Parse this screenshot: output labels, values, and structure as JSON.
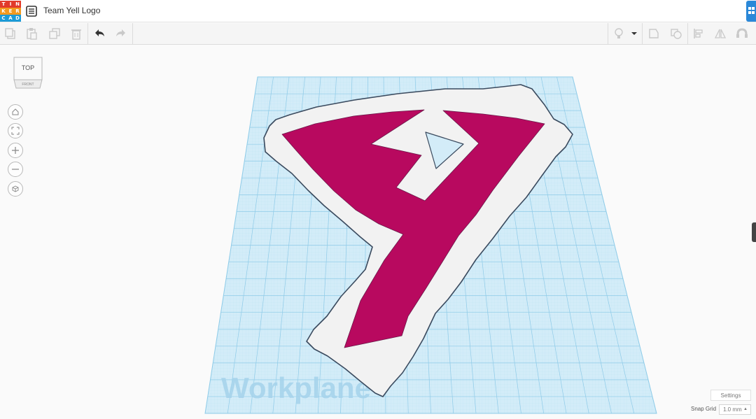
{
  "app": {
    "logo_letters": [
      "T",
      "I",
      "N",
      "K",
      "E",
      "R",
      "C",
      "A",
      "D"
    ],
    "logo_colors": [
      "#e23a2a",
      "#e23a2a",
      "#e23a2a",
      "#f29a1f",
      "#f29a1f",
      "#f29a1f",
      "#1c9bd7",
      "#1c9bd7",
      "#1c9bd7"
    ],
    "title": "Team Yell Logo",
    "accent": "#2a88d8"
  },
  "toolbar": {
    "left_tools": [
      "copy-icon",
      "paste-icon",
      "duplicate-icon",
      "delete-icon",
      "undo-icon",
      "redo-icon"
    ],
    "right_tools": [
      "light-bulb-icon",
      "dropdown-icon",
      "group-icon",
      "ungroup-icon",
      "align-icon",
      "mirror-icon",
      "magnet-icon"
    ]
  },
  "viewcube": {
    "face": "TOP",
    "side": "FRONT"
  },
  "nav": [
    "home-icon",
    "fit-view-icon",
    "zoom-in-icon",
    "zoom-out-icon",
    "perspective-icon"
  ],
  "workplane": {
    "label": "Workplane",
    "grid_color": "#a8d8ef",
    "shape_color": "#b8095f",
    "base_color": "#f2f2f2"
  },
  "footer": {
    "settings_label": "Settings",
    "snap_grid_label": "Snap Grid",
    "snap_grid_value": "1.0 mm"
  }
}
